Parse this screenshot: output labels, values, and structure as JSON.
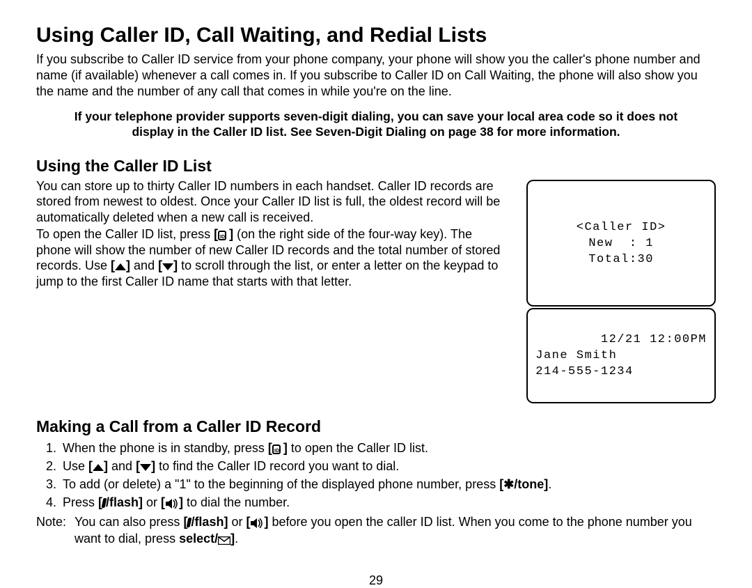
{
  "title": "Using Caller ID, Call Waiting, and Redial Lists",
  "intro": "If you subscribe to Caller ID service from your phone company, your phone will show you the caller's phone number and name (if available) whenever a call comes in. If you subscribe to Caller ID on Call Waiting, the phone will also show you the name and the number of any call that comes in while you're on the line.",
  "callout": "If your telephone provider supports seven-digit dialing, you can save your local area code so it does not display in the Caller ID list. See Seven-Digit Dialing on page 38 for more information.",
  "s1_heading": "Using the Caller ID List",
  "s1_p1": "You can store up to thirty Caller ID numbers in each handset. Caller ID records are stored from newest to oldest. Once your Caller ID list is full, the oldest record will be automatically deleted when a new call is received.",
  "s1_p2a": "To open the Caller ID list, press ",
  "s1_p2b": " (on the right side of the four-way key). The phone will show the number of new Caller ID records and the total number of stored records. Use ",
  "s1_p2c": " and ",
  "s1_p2d": " to scroll through the list, or enter a letter on the keypad to jump to the first Caller ID name that starts with that letter.",
  "lcd1_l1": "<Caller ID>",
  "lcd1_l2": "New  : 1",
  "lcd1_l3": "Total:30",
  "lcd2_l1": "12/21 12:00PM",
  "lcd2_l2": "Jane Smith",
  "lcd2_l3": "214-555-1234",
  "s2_heading": "Making a Call from a Caller ID Record",
  "step1a": "When the phone is in standby, press ",
  "step1b": " to open the Caller ID list.",
  "step2a": "Use ",
  "step2b": " and ",
  "step2c": " to find the Caller ID record you want to dial.",
  "step3a": "To add (or delete) a \"1\" to the beginning of the displayed phone number, press ",
  "step3b": "/tone]",
  "step3c": ".",
  "step4a": "Press ",
  "step4b": "/flash]",
  "step4c": " or ",
  "step4d": " to dial the number.",
  "note_label": "Note:",
  "note_a": "You can also press ",
  "note_b": "/flash]",
  "note_c": " or ",
  "note_d": " before you open the caller ID list. When you come to the phone number you want to dial, press ",
  "note_e": "select/",
  "note_f": ".",
  "page_number": "29",
  "glyph": {
    "id_key": "[ID]",
    "up_key": "[▲]",
    "down_key": "[▼]",
    "star": "[✱",
    "talk": "[",
    "speaker": "[🔊]",
    "envelope": "✉]"
  }
}
